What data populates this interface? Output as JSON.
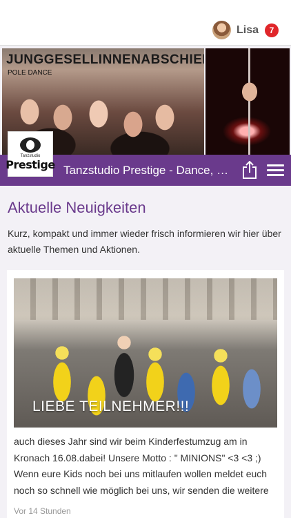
{
  "user": {
    "name": "Lisa",
    "notification_count": "7",
    "badge_color": "#e0262a"
  },
  "header": {
    "banner_title": "JUNGGESELLINNENABSCHIED",
    "banner_subtitle": "POLE DANCE",
    "logo_small": "Tanzstudio",
    "logo_big": "Prestige",
    "nav_title": "Tanzstudio Prestige -  Dance, Fitness & More",
    "nav_color": "#6a3a8c",
    "share_icon": "share-icon",
    "menu_icon": "hamburger-menu-icon"
  },
  "section": {
    "title": "Aktuelle Neuigkeiten",
    "description": "Kurz, kompakt und immer wieder frisch informieren wir hier über aktuelle Themen und Aktionen."
  },
  "post": {
    "photo_caption": "LIEBE TEILNEHMER!!!",
    "text": "auch dieses Jahr sind wir beim Kinderfestumzug am in Kronach 16.08.dabei! Unsere Motto : \" MINIONS\" <3 <3 ;) Wenn eure Kids noch bei uns mitlaufen wollen meldet euch noch so schnell wie möglich bei uns, wir senden die weitere",
    "time": "Vor 14 Stunden"
  }
}
